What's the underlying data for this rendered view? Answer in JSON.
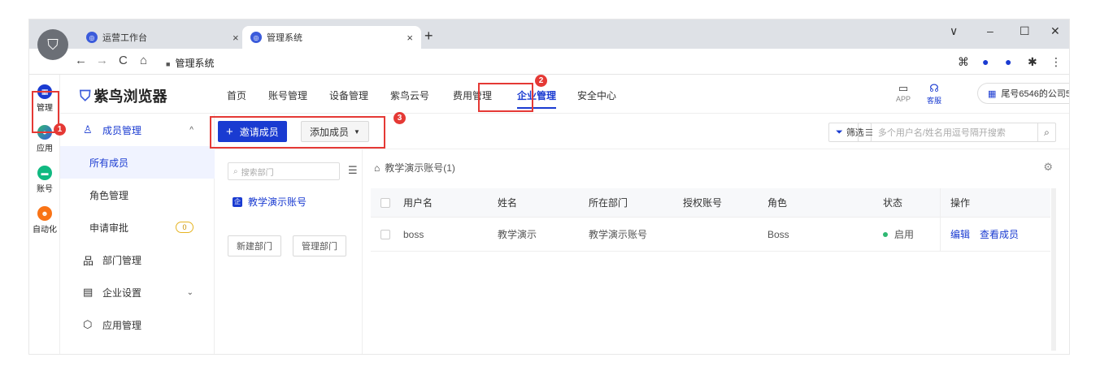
{
  "browser": {
    "tabs": [
      {
        "label": "运营工作台",
        "close": "×"
      },
      {
        "label": "管理系统",
        "close": "×"
      }
    ],
    "new_tab": "+",
    "url": "管理系统",
    "window_controls": {
      "dropdown": "∨",
      "minimize": "–",
      "maximize": "☐",
      "close": "✕"
    },
    "nav": {
      "back": "←",
      "forward": "→",
      "reload": "C",
      "home": "⌂"
    }
  },
  "rail": {
    "items": [
      {
        "label": "管理",
        "color": "#1a3bd1"
      },
      {
        "label": "应用",
        "color": "#2eb872"
      },
      {
        "label": "账号",
        "color": "#10b981"
      },
      {
        "label": "自动化",
        "color": "#f97316"
      }
    ]
  },
  "header": {
    "brand": "紫鸟浏览器",
    "nav": [
      "首页",
      "账号管理",
      "设备管理",
      "紫鸟云号",
      "费用管理",
      "企业管理",
      "安全中心"
    ],
    "app_label": "APP",
    "service_label": "客服",
    "company": "尾号6546的公司5",
    "company_chevron": "∨"
  },
  "badges": [
    "1",
    "2",
    "3"
  ],
  "sidebar": {
    "group_label": "成员管理",
    "items": [
      {
        "label": "所有成员"
      },
      {
        "label": "角色管理"
      },
      {
        "label": "申请审批",
        "count": "0"
      }
    ],
    "dept_label": "部门管理",
    "settings_label": "企业设置",
    "app_mgmt_label": "应用管理"
  },
  "toolbar": {
    "invite_label": "邀请成员",
    "add_label": "添加成员",
    "filter_label": "筛选",
    "search_placeholder": "多个用户名/姓名用逗号隔开搜索"
  },
  "dept_panel": {
    "search_placeholder": "搜索部门",
    "dept_name": "教学演示账号",
    "new_dept": "新建部门",
    "manage_dept": "管理部门"
  },
  "main": {
    "breadcrumb": "教学演示账号(1)",
    "columns": [
      "用户名",
      "姓名",
      "所在部门",
      "授权账号",
      "角色",
      "状态",
      "操作"
    ],
    "rows": [
      {
        "username": "boss",
        "name": "教学演示",
        "dept": "教学演示账号",
        "auth": "",
        "role": "Boss",
        "status": "启用",
        "ops": [
          "编辑",
          "查看成员"
        ]
      }
    ]
  },
  "colors": {
    "accent": "#1a3bd1",
    "highlight": "#e53935",
    "status_ok": "#2eb872"
  }
}
